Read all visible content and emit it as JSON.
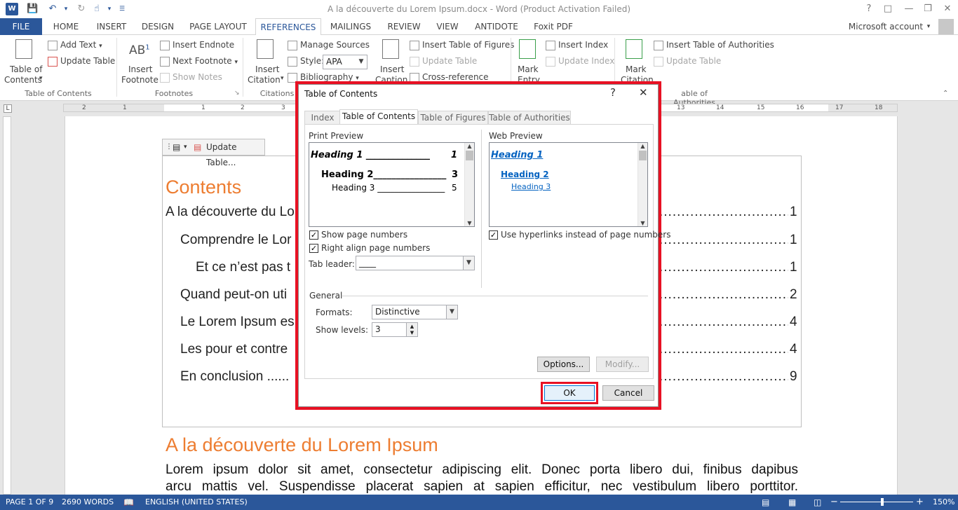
{
  "window": {
    "title": "A la découverte du Lorem Ipsum.docx - Word (Product Activation Failed)",
    "help": "?",
    "account": "Microsoft account"
  },
  "tabs": [
    "FILE",
    "HOME",
    "INSERT",
    "DESIGN",
    "PAGE LAYOUT",
    "REFERENCES",
    "MAILINGS",
    "REVIEW",
    "VIEW",
    "ANTIDOTE",
    "Foxit PDF"
  ],
  "ribbon": {
    "toc_group": {
      "toc_button_line1": "Table of",
      "toc_button_line2": "Contents",
      "add_text": "Add Text",
      "update_table": "Update Table",
      "label": "Table of Contents"
    },
    "footnotes_group": {
      "insert_footnote_line1": "Insert",
      "insert_footnote_line2": "Footnote",
      "insert_endnote": "Insert Endnote",
      "next_footnote": "Next Footnote",
      "show_notes": "Show Notes",
      "label": "Footnotes",
      "ab_glyph": "AB"
    },
    "citations_group": {
      "insert_citation_line1": "Insert",
      "insert_citation_line2": "Citation",
      "manage_sources": "Manage Sources",
      "style_label": "Style:",
      "style_value": "APA",
      "bibliography": "Bibliography",
      "label": "Citations"
    },
    "captions_group": {
      "insert_caption_line1": "Insert",
      "insert_caption_line2": "Caption",
      "insert_table_of_figures": "Insert Table of Figures",
      "update_table": "Update Table",
      "cross_reference": "Cross-reference"
    },
    "index_group": {
      "mark_entry_line1": "Mark",
      "mark_entry_line2": "Entry",
      "insert_index": "Insert Index",
      "update_index": "Update Index"
    },
    "authorities_group": {
      "mark_citation_line1": "Mark",
      "mark_citation_line2": "Citation",
      "insert_toa": "Insert Table of Authorities",
      "update_table": "Update Table",
      "label": "able of Authorities"
    }
  },
  "ruler_numbers": [
    "2",
    "1",
    "1",
    "2",
    "3",
    "13",
    "14",
    "15",
    "16",
    "17",
    "18"
  ],
  "document": {
    "toc_toolbar_label": "Update Table...",
    "toc_heading": "Contents",
    "toc_entries": [
      {
        "text": "A la découverte du Lo",
        "page": "1"
      },
      {
        "text": "Comprendre le Lor",
        "page": "1"
      },
      {
        "text": "Et ce n’est pas t",
        "page": "1"
      },
      {
        "text": "Quand peut-on uti",
        "page": "2"
      },
      {
        "text": "Le Lorem Ipsum es",
        "page": "4"
      },
      {
        "text": "Les pour et contre",
        "page": "4"
      },
      {
        "text": "En conclusion ......",
        "page": "9"
      }
    ],
    "heading1": "A la découverte du Lorem Ipsum",
    "para_line1": "Lorem ipsum dolor sit amet, consectetur adipiscing elit. Donec porta libero dui, finibus dapibus",
    "para_line2": "arcu mattis vel. Suspendisse placerat sapien at sapien efficitur, nec vestibulum libero porttitor."
  },
  "dialog": {
    "title": "Table of Contents",
    "help": "?",
    "tabs": [
      "Index",
      "Table of Contents",
      "Table of Figures",
      "Table of Authorities"
    ],
    "print_preview_label": "Print Preview",
    "web_preview_label": "Web Preview",
    "print_preview": {
      "h1": "Heading 1",
      "h1_page": "1",
      "h2": "Heading 2",
      "h2_page": "3",
      "h3": "Heading 3",
      "h3_page": "5"
    },
    "web_preview": {
      "h1": "Heading 1",
      "h2": "Heading 2",
      "h3": "Heading 3"
    },
    "show_page_numbers": "Show page numbers",
    "right_align": "Right align page numbers",
    "use_hyperlinks": "Use hyperlinks instead of page numbers",
    "tab_leader_label": "Tab leader:",
    "tab_leader_value": "____",
    "general_label": "General",
    "formats_label": "Formats:",
    "formats_value": "Distinctive",
    "show_levels_label": "Show levels:",
    "show_levels_value": "3",
    "options_button": "Options...",
    "modify_button": "Modify...",
    "ok_button": "OK",
    "cancel_button": "Cancel"
  },
  "status": {
    "page": "PAGE 1 OF 9",
    "words": "2690 WORDS",
    "language": "ENGLISH (UNITED STATES)",
    "zoom": "150%"
  },
  "colors": {
    "brand": "#2b579a",
    "heading": "#ed7d31",
    "highlight": "#e81123",
    "link": "#0563c1"
  }
}
